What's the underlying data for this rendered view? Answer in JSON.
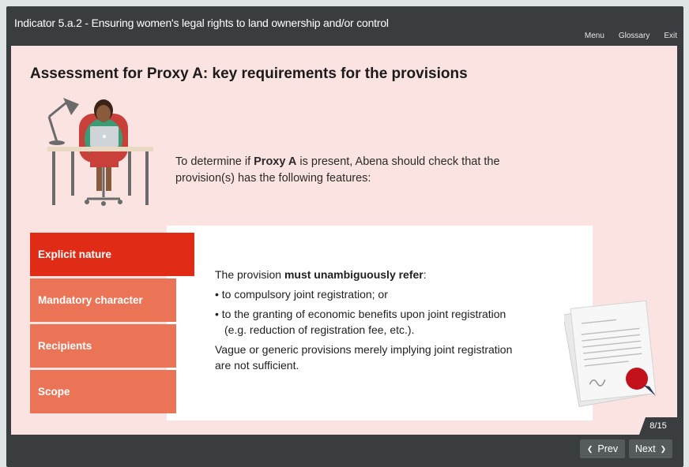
{
  "header": {
    "title": "Indicator 5.a.2 - Ensuring women's legal rights to land ownership and/or control",
    "nav": [
      "Menu",
      "Glossary",
      "Exit"
    ]
  },
  "slide": {
    "title": "Assessment for Proxy A: key requirements for the provisions",
    "intro": {
      "part1": "To determine if ",
      "bold": "Proxy A",
      "part2": " is present, Abena should check that the provision(s) has the following features:"
    },
    "tabs": [
      "Explicit nature",
      "Mandatory character",
      "Recipients",
      "Scope"
    ],
    "active_tab": "Explicit nature",
    "content": {
      "lead_part1": "The provision ",
      "lead_bold": "must unambiguously refer",
      "lead_part2": ":",
      "bullets": [
        "• to compulsory joint registration; or",
        "• to the granting of economic benefits upon joint registration (e.g. reduction of registration fee, etc.)."
      ],
      "note": "Vague or generic provisions merely implying joint registration are not sufficient."
    },
    "page_counter": "8/15"
  },
  "footer": {
    "prev": "Prev",
    "next": "Next"
  },
  "colors": {
    "frame": "#3a3d3f",
    "slide_bg": "#fbe3e2",
    "tab": "#ec7456",
    "tab_active": "#e02b17"
  }
}
